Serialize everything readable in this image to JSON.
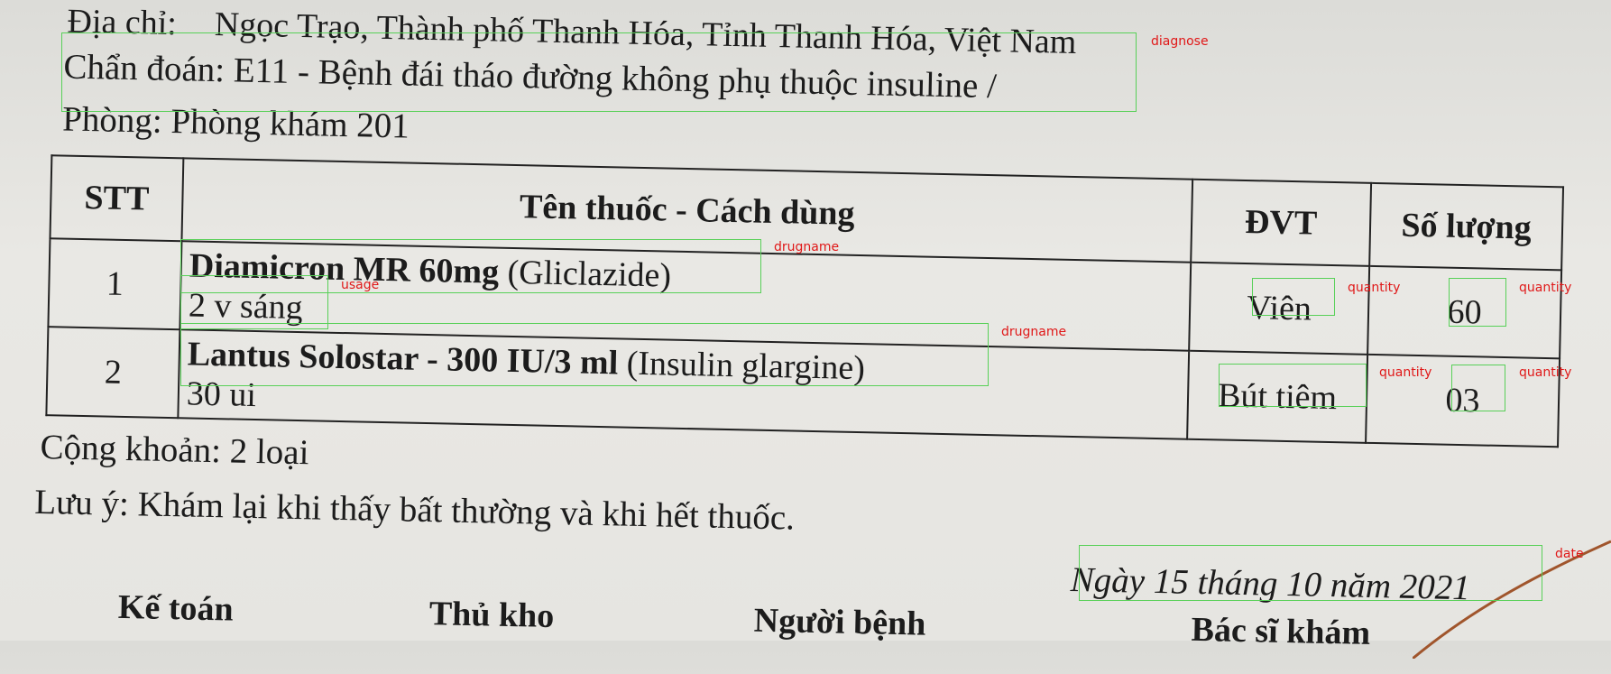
{
  "header": {
    "address_label": "Địa chỉ:",
    "address_value": "Ngọc Trạo, Thành phố Thanh Hóa, Tỉnh Thanh Hóa, Việt Nam",
    "diagnosis": "Chẩn đoán: E11 - Bệnh đái tháo đường không phụ thuộc insuline /",
    "room": "Phòng: Phòng khám 201"
  },
  "table": {
    "headers": [
      "STT",
      "Tên thuốc - Cách dùng",
      "ĐVT",
      "Số lượng"
    ],
    "rows": [
      {
        "stt": "1",
        "drug_bold": "Diamicron MR 60mg",
        "drug_generic": "(Gliclazide)",
        "usage": "2 v sáng",
        "unit": "Viên",
        "qty": "60"
      },
      {
        "stt": "2",
        "drug_bold": "Lantus Solostar - 300 IU/3 ml",
        "drug_generic": "(Insulin glargine)",
        "usage": "30 ui",
        "unit": "Bút tiêm",
        "qty": "03"
      }
    ]
  },
  "footer": {
    "total": "Cộng khoản: 2 loại",
    "note": "Lưu ý: Khám lại khi thấy bất thường và khi hết thuốc.",
    "date": "Ngày 15 tháng 10 năm 2021",
    "signatures": [
      "Kế toán",
      "Thủ kho",
      "Người bệnh",
      "Bác sĩ khám"
    ]
  },
  "annotations": {
    "diagnose": "diagnose",
    "drugname": "drugname",
    "usage": "usage",
    "quantity": "quantity",
    "date": "date"
  },
  "colors": {
    "annotation_box": "#58d058",
    "annotation_label": "#e01818",
    "pen_ink": "#a0552c"
  }
}
